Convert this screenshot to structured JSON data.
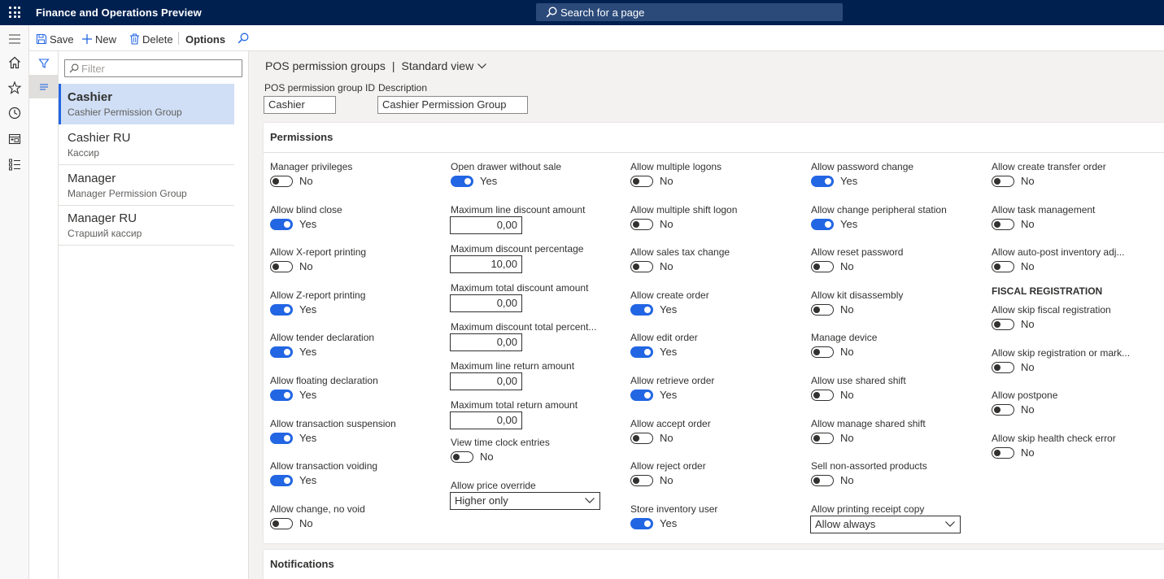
{
  "topbar": {
    "app_title": "Finance and Operations Preview",
    "search_placeholder": "Search for a page"
  },
  "actions": {
    "save": "Save",
    "new": "New",
    "delete": "Delete",
    "options": "Options"
  },
  "list": {
    "filter_placeholder": "Filter",
    "items": [
      {
        "title": "Cashier",
        "subtitle": "Cashier Permission Group",
        "selected": true
      },
      {
        "title": "Cashier RU",
        "subtitle": "Кассир",
        "selected": false
      },
      {
        "title": "Manager",
        "subtitle": "Manager Permission Group",
        "selected": false
      },
      {
        "title": "Manager RU",
        "subtitle": "Старший кассир",
        "selected": false
      }
    ]
  },
  "page": {
    "breadcrumb": "POS permission groups",
    "separator": "|",
    "view": "Standard view",
    "group_id_label": "POS permission group ID",
    "group_id_value": "Cashier",
    "description_label": "Description",
    "description_value": "Cashier Permission Group"
  },
  "permissions": {
    "title": "Permissions",
    "col1": [
      {
        "label": "Manager privileges",
        "value": "No"
      },
      {
        "label": "Allow blind close",
        "value": "Yes"
      },
      {
        "label": "Allow X-report printing",
        "value": "No"
      },
      {
        "label": "Allow Z-report printing",
        "value": "Yes"
      },
      {
        "label": "Allow tender declaration",
        "value": "Yes"
      },
      {
        "label": "Allow floating declaration",
        "value": "Yes"
      },
      {
        "label": "Allow transaction suspension",
        "value": "Yes"
      },
      {
        "label": "Allow transaction voiding",
        "value": "Yes"
      },
      {
        "label": "Allow change, no void",
        "value": "No"
      }
    ],
    "col2_toggle_top": {
      "label": "Open drawer without sale",
      "value": "Yes"
    },
    "col2_numbers": [
      {
        "label": "Maximum line discount amount",
        "value": "0,00"
      },
      {
        "label": "Maximum discount percentage",
        "value": "10,00"
      },
      {
        "label": "Maximum total discount amount",
        "value": "0,00"
      },
      {
        "label": "Maximum discount total percent...",
        "value": "0,00"
      },
      {
        "label": "Maximum line return amount",
        "value": "0,00"
      },
      {
        "label": "Maximum total return amount",
        "value": "0,00"
      }
    ],
    "col2_toggle_bottom": {
      "label": "View time clock entries",
      "value": "No"
    },
    "col2_select": {
      "label": "Allow price override",
      "value": "Higher only"
    },
    "col3": [
      {
        "label": "Allow multiple logons",
        "value": "No"
      },
      {
        "label": "Allow multiple shift logon",
        "value": "No"
      },
      {
        "label": "Allow sales tax change",
        "value": "No"
      },
      {
        "label": "Allow create order",
        "value": "Yes"
      },
      {
        "label": "Allow edit order",
        "value": "Yes"
      },
      {
        "label": "Allow retrieve order",
        "value": "Yes"
      },
      {
        "label": "Allow accept order",
        "value": "No"
      },
      {
        "label": "Allow reject order",
        "value": "No"
      },
      {
        "label": "Store inventory user",
        "value": "Yes"
      }
    ],
    "col4": [
      {
        "label": "Allow password change",
        "value": "Yes"
      },
      {
        "label": "Allow change peripheral station",
        "value": "Yes"
      },
      {
        "label": "Allow reset password",
        "value": "No"
      },
      {
        "label": "Allow kit disassembly",
        "value": "No"
      },
      {
        "label": "Manage device",
        "value": "No"
      },
      {
        "label": "Allow use shared shift",
        "value": "No"
      },
      {
        "label": "Allow manage shared shift",
        "value": "No"
      },
      {
        "label": "Sell non-assorted products",
        "value": "No"
      }
    ],
    "col4_select": {
      "label": "Allow printing receipt copy",
      "value": "Allow always"
    },
    "col5": [
      {
        "label": "Allow create transfer order",
        "value": "No"
      },
      {
        "label": "Allow task management",
        "value": "No"
      },
      {
        "label": "Allow auto-post inventory adj...",
        "value": "No"
      }
    ],
    "fiscal_header": "FISCAL REGISTRATION",
    "col5_fiscal": [
      {
        "label": "Allow skip fiscal registration",
        "value": "No"
      },
      {
        "label": "Allow skip registration or mark...",
        "value": "No"
      },
      {
        "label": "Allow postpone",
        "value": "No"
      },
      {
        "label": "Allow skip health check error",
        "value": "No"
      }
    ]
  },
  "notifications": {
    "title": "Notifications"
  },
  "colors": {
    "topbar": "#002050",
    "accent": "#2266e3",
    "selected_row": "#d0dff5"
  }
}
